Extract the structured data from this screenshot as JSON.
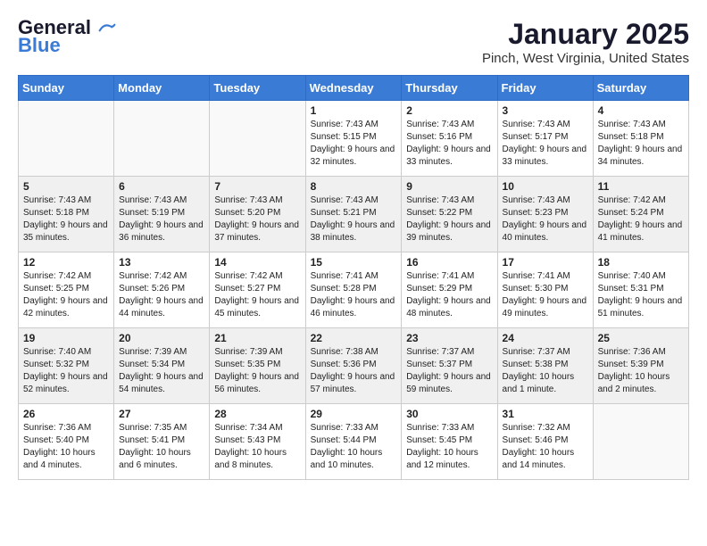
{
  "header": {
    "logo_line1": "General",
    "logo_line2": "Blue",
    "month_title": "January 2025",
    "location": "Pinch, West Virginia, United States"
  },
  "weekdays": [
    "Sunday",
    "Monday",
    "Tuesday",
    "Wednesday",
    "Thursday",
    "Friday",
    "Saturday"
  ],
  "weeks": [
    [
      {
        "day": "",
        "info": ""
      },
      {
        "day": "",
        "info": ""
      },
      {
        "day": "",
        "info": ""
      },
      {
        "day": "1",
        "info": "Sunrise: 7:43 AM\nSunset: 5:15 PM\nDaylight: 9 hours and 32 minutes."
      },
      {
        "day": "2",
        "info": "Sunrise: 7:43 AM\nSunset: 5:16 PM\nDaylight: 9 hours and 33 minutes."
      },
      {
        "day": "3",
        "info": "Sunrise: 7:43 AM\nSunset: 5:17 PM\nDaylight: 9 hours and 33 minutes."
      },
      {
        "day": "4",
        "info": "Sunrise: 7:43 AM\nSunset: 5:18 PM\nDaylight: 9 hours and 34 minutes."
      }
    ],
    [
      {
        "day": "5",
        "info": "Sunrise: 7:43 AM\nSunset: 5:18 PM\nDaylight: 9 hours and 35 minutes."
      },
      {
        "day": "6",
        "info": "Sunrise: 7:43 AM\nSunset: 5:19 PM\nDaylight: 9 hours and 36 minutes."
      },
      {
        "day": "7",
        "info": "Sunrise: 7:43 AM\nSunset: 5:20 PM\nDaylight: 9 hours and 37 minutes."
      },
      {
        "day": "8",
        "info": "Sunrise: 7:43 AM\nSunset: 5:21 PM\nDaylight: 9 hours and 38 minutes."
      },
      {
        "day": "9",
        "info": "Sunrise: 7:43 AM\nSunset: 5:22 PM\nDaylight: 9 hours and 39 minutes."
      },
      {
        "day": "10",
        "info": "Sunrise: 7:43 AM\nSunset: 5:23 PM\nDaylight: 9 hours and 40 minutes."
      },
      {
        "day": "11",
        "info": "Sunrise: 7:42 AM\nSunset: 5:24 PM\nDaylight: 9 hours and 41 minutes."
      }
    ],
    [
      {
        "day": "12",
        "info": "Sunrise: 7:42 AM\nSunset: 5:25 PM\nDaylight: 9 hours and 42 minutes."
      },
      {
        "day": "13",
        "info": "Sunrise: 7:42 AM\nSunset: 5:26 PM\nDaylight: 9 hours and 44 minutes."
      },
      {
        "day": "14",
        "info": "Sunrise: 7:42 AM\nSunset: 5:27 PM\nDaylight: 9 hours and 45 minutes."
      },
      {
        "day": "15",
        "info": "Sunrise: 7:41 AM\nSunset: 5:28 PM\nDaylight: 9 hours and 46 minutes."
      },
      {
        "day": "16",
        "info": "Sunrise: 7:41 AM\nSunset: 5:29 PM\nDaylight: 9 hours and 48 minutes."
      },
      {
        "day": "17",
        "info": "Sunrise: 7:41 AM\nSunset: 5:30 PM\nDaylight: 9 hours and 49 minutes."
      },
      {
        "day": "18",
        "info": "Sunrise: 7:40 AM\nSunset: 5:31 PM\nDaylight: 9 hours and 51 minutes."
      }
    ],
    [
      {
        "day": "19",
        "info": "Sunrise: 7:40 AM\nSunset: 5:32 PM\nDaylight: 9 hours and 52 minutes."
      },
      {
        "day": "20",
        "info": "Sunrise: 7:39 AM\nSunset: 5:34 PM\nDaylight: 9 hours and 54 minutes."
      },
      {
        "day": "21",
        "info": "Sunrise: 7:39 AM\nSunset: 5:35 PM\nDaylight: 9 hours and 56 minutes."
      },
      {
        "day": "22",
        "info": "Sunrise: 7:38 AM\nSunset: 5:36 PM\nDaylight: 9 hours and 57 minutes."
      },
      {
        "day": "23",
        "info": "Sunrise: 7:37 AM\nSunset: 5:37 PM\nDaylight: 9 hours and 59 minutes."
      },
      {
        "day": "24",
        "info": "Sunrise: 7:37 AM\nSunset: 5:38 PM\nDaylight: 10 hours and 1 minute."
      },
      {
        "day": "25",
        "info": "Sunrise: 7:36 AM\nSunset: 5:39 PM\nDaylight: 10 hours and 2 minutes."
      }
    ],
    [
      {
        "day": "26",
        "info": "Sunrise: 7:36 AM\nSunset: 5:40 PM\nDaylight: 10 hours and 4 minutes."
      },
      {
        "day": "27",
        "info": "Sunrise: 7:35 AM\nSunset: 5:41 PM\nDaylight: 10 hours and 6 minutes."
      },
      {
        "day": "28",
        "info": "Sunrise: 7:34 AM\nSunset: 5:43 PM\nDaylight: 10 hours and 8 minutes."
      },
      {
        "day": "29",
        "info": "Sunrise: 7:33 AM\nSunset: 5:44 PM\nDaylight: 10 hours and 10 minutes."
      },
      {
        "day": "30",
        "info": "Sunrise: 7:33 AM\nSunset: 5:45 PM\nDaylight: 10 hours and 12 minutes."
      },
      {
        "day": "31",
        "info": "Sunrise: 7:32 AM\nSunset: 5:46 PM\nDaylight: 10 hours and 14 minutes."
      },
      {
        "day": "",
        "info": ""
      }
    ]
  ]
}
